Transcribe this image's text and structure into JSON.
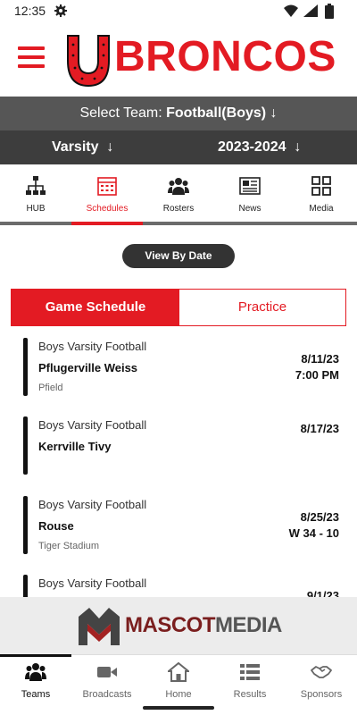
{
  "status": {
    "time": "12:35"
  },
  "header": {
    "brand": "BRONCOS"
  },
  "team_selector": {
    "prefix": "Select Team:",
    "team": "Football(Boys)",
    "level": "Varsity",
    "season": "2023-2024",
    "arrow": "↓"
  },
  "nav": [
    {
      "label": "HUB",
      "icon": "hierarchy-icon"
    },
    {
      "label": "Schedules",
      "icon": "calendar-icon",
      "active": true
    },
    {
      "label": "Rosters",
      "icon": "people-icon"
    },
    {
      "label": "News",
      "icon": "newspaper-icon"
    },
    {
      "label": "Media",
      "icon": "grid-icon"
    }
  ],
  "view_by_date": "View By Date",
  "segments": {
    "active": "Game Schedule",
    "inactive": "Practice"
  },
  "games": [
    {
      "sport": "Boys Varsity Football",
      "opponent": "Pflugerville Weiss",
      "location": "Pfield",
      "date": "8/11/23",
      "sub": "7:00 PM"
    },
    {
      "sport": "Boys Varsity Football",
      "opponent": "Kerrville Tivy",
      "location": "",
      "date": "8/17/23",
      "sub": ""
    },
    {
      "sport": "Boys Varsity Football",
      "opponent": "Rouse",
      "location": "Tiger Stadium",
      "date": "8/25/23",
      "sub": "W 34 - 10"
    },
    {
      "sport": "Boys Varsity Football",
      "opponent": "",
      "location": "",
      "date": "9/1/23",
      "sub": ""
    }
  ],
  "sponsor": {
    "name_a": "MASCOT",
    "name_b": "MEDIA"
  },
  "bottom_nav": [
    {
      "label": "Teams",
      "icon": "teams-icon",
      "active": true
    },
    {
      "label": "Broadcasts",
      "icon": "video-camera-icon"
    },
    {
      "label": "Home",
      "icon": "home-icon"
    },
    {
      "label": "Results",
      "icon": "list-icon"
    },
    {
      "label": "Sponsors",
      "icon": "handshake-icon"
    }
  ],
  "colors": {
    "accent": "#e31b23",
    "band_light": "#565656",
    "band_dark": "#3d3d3d"
  }
}
